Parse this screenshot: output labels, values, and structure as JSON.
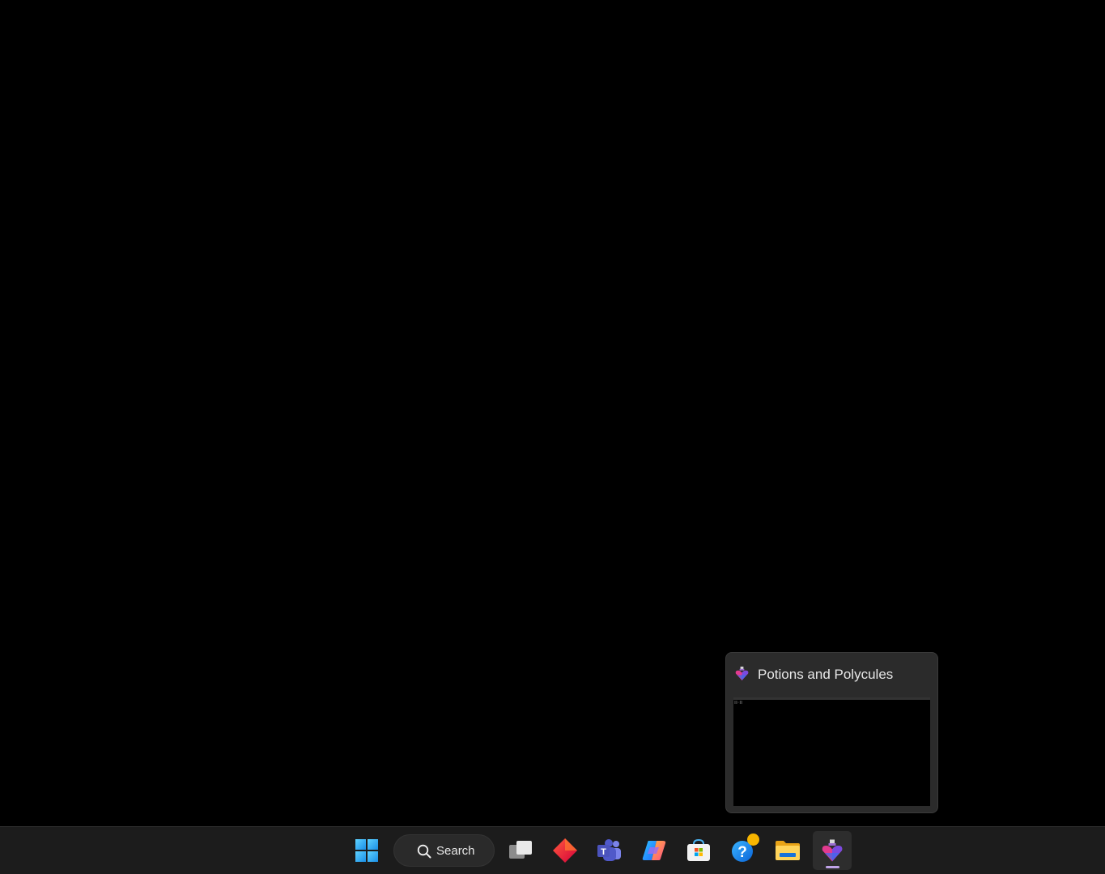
{
  "desktop": {
    "background_color": "#000000"
  },
  "preview": {
    "title": "Potions and Polycules",
    "app_icon": "potion-heart-icon",
    "thumbnail_background": "#000000"
  },
  "taskbar": {
    "background_color": "#1c1c1c",
    "search": {
      "label": "Search",
      "icon": "search-icon"
    },
    "items": [
      {
        "name": "start",
        "icon": "windows-logo-icon"
      },
      {
        "name": "task-view",
        "icon": "task-view-icon"
      },
      {
        "name": "app-red-diamond",
        "icon": "red-diamond-app-icon"
      },
      {
        "name": "teams",
        "icon": "teams-icon"
      },
      {
        "name": "copilot",
        "icon": "copilot-icon"
      },
      {
        "name": "microsoft-store",
        "icon": "store-icon"
      },
      {
        "name": "get-help",
        "icon": "help-icon",
        "has_badge": true
      },
      {
        "name": "file-explorer",
        "icon": "folder-icon"
      },
      {
        "name": "potions-and-polycules",
        "icon": "potion-heart-icon",
        "active": true
      }
    ],
    "active_indicator_color": "#c0a3e8"
  }
}
